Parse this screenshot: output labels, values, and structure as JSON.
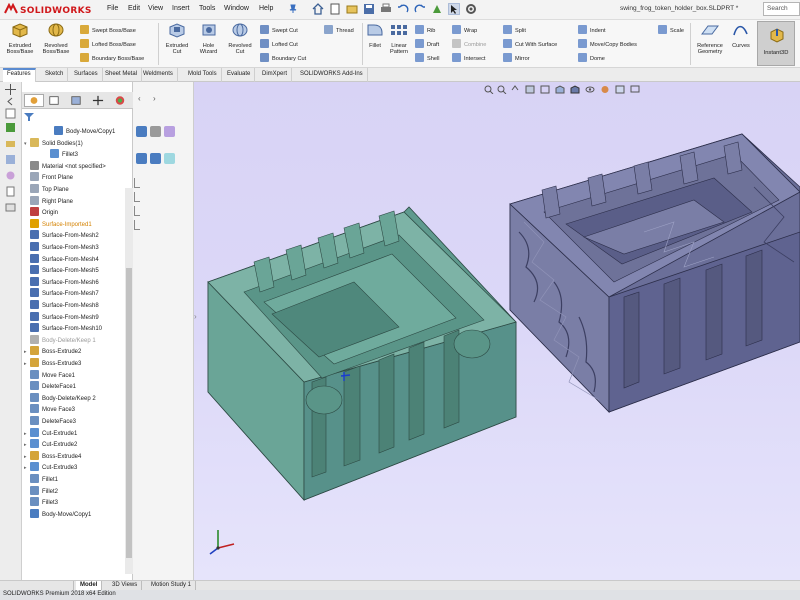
{
  "app": {
    "logo_text": "SOLIDWORKS",
    "document_title": "swing_frog_token_holder_box.SLDPRT *",
    "search_placeholder": "Search"
  },
  "menu": {
    "items": [
      "File",
      "Edit",
      "View",
      "Insert",
      "Tools",
      "Window",
      "Help"
    ]
  },
  "ribbon": {
    "big_buttons": [
      {
        "label": "Extruded\nBoss/Base",
        "icon": "extruded-boss-icon"
      },
      {
        "label": "Revolved\nBoss/Base",
        "icon": "revolved-boss-icon"
      },
      {
        "label": "Extruded\nCut",
        "icon": "extruded-cut-icon"
      },
      {
        "label": "Hole\nWizard",
        "icon": "hole-wizard-icon"
      },
      {
        "label": "Revolved\nCut",
        "icon": "revolved-cut-icon"
      },
      {
        "label": "Fillet",
        "icon": "fillet-icon"
      },
      {
        "label": "Linear\nPattern",
        "icon": "linear-pattern-icon"
      },
      {
        "label": "Reference\nGeometry",
        "icon": "reference-geometry-icon"
      },
      {
        "label": "Curves",
        "icon": "curves-icon"
      }
    ],
    "small_buttons": {
      "swept_boss": "Swept Boss/Base",
      "lofted_boss": "Lofted Boss/Base",
      "boundary_boss": "Boundary Boss/Base",
      "swept_cut": "Swept Cut",
      "lofted_cut": "Lofted Cut",
      "boundary_cut": "Boundary Cut",
      "thread": "Thread",
      "rib": "Rib",
      "draft": "Draft",
      "shell": "Shell",
      "wrap": "Wrap",
      "combine": "Combine",
      "intersect": "Intersect",
      "split": "Split",
      "cut_with_surface": "Cut With Surface",
      "mirror": "Mirror",
      "indent": "Indent",
      "move_copy_bodies": "Move/Copy Bodies",
      "dome": "Dome",
      "scale": "Scale"
    },
    "instant3d": "Instant3D"
  },
  "tabs": [
    "Features",
    "Sketch",
    "Surfaces",
    "Sheet Metal",
    "Weldments",
    "Mold Tools",
    "Evaluate",
    "DimXpert",
    "SOLIDWORKS Add-Ins"
  ],
  "tree": {
    "nodes": [
      {
        "label": "Body-Move/Copy1",
        "level": 2,
        "icon": "move-body-icon",
        "color": "#4a7cc0",
        "state": "normal",
        "expander": ""
      },
      {
        "label": "Solid Bodies(1)",
        "level": 1,
        "icon": "solid-bodies-folder-icon",
        "color": "#d9b85a",
        "state": "normal",
        "expander": "▾"
      },
      {
        "label": "Fillet3",
        "level": 3,
        "icon": "solid-body-icon",
        "color": "#5a8fd0",
        "state": "normal",
        "expander": ""
      },
      {
        "label": "Material <not specified>",
        "level": 1,
        "icon": "material-icon",
        "color": "#8a8a8a",
        "state": "normal",
        "expander": ""
      },
      {
        "label": "Front Plane",
        "level": 1,
        "icon": "plane-icon",
        "color": "#9aa6b8",
        "state": "normal",
        "expander": ""
      },
      {
        "label": "Top Plane",
        "level": 1,
        "icon": "plane-icon",
        "color": "#9aa6b8",
        "state": "normal",
        "expander": ""
      },
      {
        "label": "Right Plane",
        "level": 1,
        "icon": "plane-icon",
        "color": "#9aa6b8",
        "state": "normal",
        "expander": ""
      },
      {
        "label": "Origin",
        "level": 1,
        "icon": "origin-icon",
        "color": "#c04040",
        "state": "normal",
        "expander": ""
      },
      {
        "label": "Surface-Imported1",
        "level": 1,
        "icon": "warning-icon",
        "color": "#e0a000",
        "state": "warn",
        "expander": ""
      },
      {
        "label": "Surface-From-Mesh2",
        "level": 1,
        "icon": "surface-icon",
        "color": "#4a6fb0",
        "state": "normal",
        "expander": ""
      },
      {
        "label": "Surface-From-Mesh3",
        "level": 1,
        "icon": "surface-icon",
        "color": "#4a6fb0",
        "state": "normal",
        "expander": ""
      },
      {
        "label": "Surface-From-Mesh4",
        "level": 1,
        "icon": "surface-icon",
        "color": "#4a6fb0",
        "state": "normal",
        "expander": ""
      },
      {
        "label": "Surface-From-Mesh5",
        "level": 1,
        "icon": "surface-icon",
        "color": "#4a6fb0",
        "state": "normal",
        "expander": ""
      },
      {
        "label": "Surface-From-Mesh6",
        "level": 1,
        "icon": "surface-icon",
        "color": "#4a6fb0",
        "state": "normal",
        "expander": ""
      },
      {
        "label": "Surface-From-Mesh7",
        "level": 1,
        "icon": "surface-icon",
        "color": "#4a6fb0",
        "state": "normal",
        "expander": ""
      },
      {
        "label": "Surface-From-Mesh8",
        "level": 1,
        "icon": "surface-icon",
        "color": "#4a6fb0",
        "state": "normal",
        "expander": ""
      },
      {
        "label": "Surface-From-Mesh9",
        "level": 1,
        "icon": "surface-icon",
        "color": "#4a6fb0",
        "state": "normal",
        "expander": ""
      },
      {
        "label": "Surface-From-Mesh10",
        "level": 1,
        "icon": "surface-icon",
        "color": "#4a6fb0",
        "state": "normal",
        "expander": ""
      },
      {
        "label": "Body-Delete/Keep 1",
        "level": 1,
        "icon": "body-delete-icon",
        "color": "#b0b0b0",
        "state": "dim",
        "expander": ""
      },
      {
        "label": "Boss-Extrude2",
        "level": 1,
        "icon": "extrude-icon",
        "color": "#d4a43a",
        "state": "normal",
        "expander": "▸"
      },
      {
        "label": "Boss-Extrude3",
        "level": 1,
        "icon": "extrude-icon",
        "color": "#d4a43a",
        "state": "normal",
        "expander": "▸"
      },
      {
        "label": "Move Face1",
        "level": 1,
        "icon": "move-face-icon",
        "color": "#6a8fc0",
        "state": "normal",
        "expander": ""
      },
      {
        "label": "DeleteFace1",
        "level": 1,
        "icon": "delete-face-icon",
        "color": "#6a8fc0",
        "state": "normal",
        "expander": ""
      },
      {
        "label": "Body-Delete/Keep 2",
        "level": 1,
        "icon": "body-delete-icon",
        "color": "#6a8fc0",
        "state": "normal",
        "expander": ""
      },
      {
        "label": "Move Face3",
        "level": 1,
        "icon": "move-face-icon",
        "color": "#6a8fc0",
        "state": "normal",
        "expander": ""
      },
      {
        "label": "DeleteFace3",
        "level": 1,
        "icon": "delete-face-icon",
        "color": "#6a8fc0",
        "state": "normal",
        "expander": ""
      },
      {
        "label": "Cut-Extrude1",
        "level": 1,
        "icon": "cut-extrude-icon",
        "color": "#5a8fd0",
        "state": "normal",
        "expander": "▸"
      },
      {
        "label": "Cut-Extrude2",
        "level": 1,
        "icon": "cut-extrude-icon",
        "color": "#5a8fd0",
        "state": "normal",
        "expander": "▸"
      },
      {
        "label": "Boss-Extrude4",
        "level": 1,
        "icon": "extrude-icon",
        "color": "#d4a43a",
        "state": "normal",
        "expander": "▸"
      },
      {
        "label": "Cut-Extrude3",
        "level": 1,
        "icon": "cut-extrude-icon",
        "color": "#5a8fd0",
        "state": "normal",
        "expander": "▸"
      },
      {
        "label": "Fillet1",
        "level": 1,
        "icon": "fillet-icon",
        "color": "#6a8fc0",
        "state": "normal",
        "expander": ""
      },
      {
        "label": "Fillet2",
        "level": 1,
        "icon": "fillet-icon",
        "color": "#6a8fc0",
        "state": "normal",
        "expander": ""
      },
      {
        "label": "Fillet3",
        "level": 1,
        "icon": "fillet-icon",
        "color": "#6a8fc0",
        "state": "normal",
        "expander": ""
      },
      {
        "label": "Body-Move/Copy1",
        "level": 1,
        "icon": "move-body-icon",
        "color": "#4a7cc0",
        "state": "normal",
        "expander": ""
      }
    ]
  },
  "bottom_tabs": [
    "Model",
    "3D Views",
    "Motion Study 1"
  ],
  "status": "SOLIDWORKS Premium 2018 x64 Edition",
  "colors": {
    "model_left": "#5f9a8e",
    "model_right": "#6b6f99",
    "viewport_top": "#d8d3f5",
    "accent": "#5b8bd0"
  }
}
